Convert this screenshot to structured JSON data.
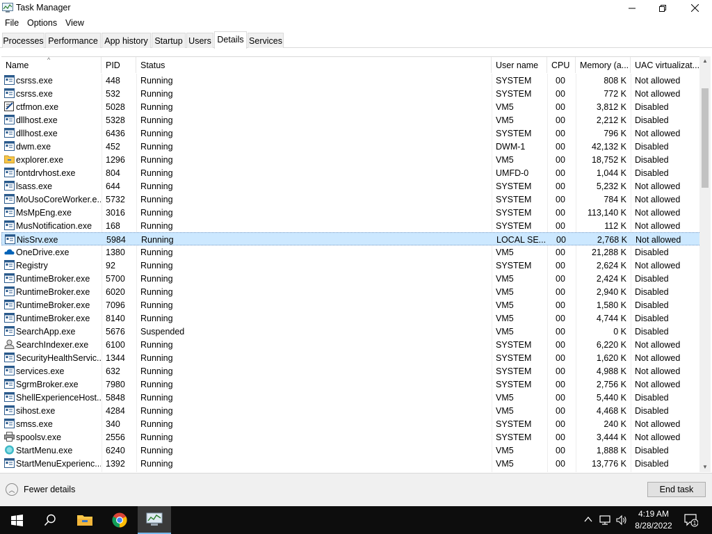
{
  "window": {
    "title": "Task Manager"
  },
  "menu": [
    "File",
    "Options",
    "View"
  ],
  "tabs": [
    {
      "label": "Processes",
      "active": false
    },
    {
      "label": "Performance",
      "active": false
    },
    {
      "label": "App history",
      "active": false
    },
    {
      "label": "Startup",
      "active": false
    },
    {
      "label": "Users",
      "active": false
    },
    {
      "label": "Details",
      "active": true
    },
    {
      "label": "Services",
      "active": false
    }
  ],
  "columns": [
    "Name",
    "PID",
    "Status",
    "User name",
    "CPU",
    "Memory (a...",
    "UAC virtualizat..."
  ],
  "rows": [
    {
      "icon": "generic-app-icon",
      "name": "csrss.exe",
      "pid": "448",
      "status": "Running",
      "user": "SYSTEM",
      "cpu": "00",
      "memory": "808 K",
      "uac": "Not allowed"
    },
    {
      "icon": "generic-app-icon",
      "name": "csrss.exe",
      "pid": "532",
      "status": "Running",
      "user": "SYSTEM",
      "cpu": "00",
      "memory": "772 K",
      "uac": "Not allowed"
    },
    {
      "icon": "ctfmon-icon",
      "name": "ctfmon.exe",
      "pid": "5028",
      "status": "Running",
      "user": "VM5",
      "cpu": "00",
      "memory": "3,812 K",
      "uac": "Disabled"
    },
    {
      "icon": "generic-app-icon",
      "name": "dllhost.exe",
      "pid": "5328",
      "status": "Running",
      "user": "VM5",
      "cpu": "00",
      "memory": "2,212 K",
      "uac": "Disabled"
    },
    {
      "icon": "generic-app-icon",
      "name": "dllhost.exe",
      "pid": "6436",
      "status": "Running",
      "user": "SYSTEM",
      "cpu": "00",
      "memory": "796 K",
      "uac": "Not allowed"
    },
    {
      "icon": "generic-app-icon",
      "name": "dwm.exe",
      "pid": "452",
      "status": "Running",
      "user": "DWM-1",
      "cpu": "00",
      "memory": "42,132 K",
      "uac": "Disabled"
    },
    {
      "icon": "folder-icon",
      "name": "explorer.exe",
      "pid": "1296",
      "status": "Running",
      "user": "VM5",
      "cpu": "00",
      "memory": "18,752 K",
      "uac": "Disabled"
    },
    {
      "icon": "generic-app-icon",
      "name": "fontdrvhost.exe",
      "pid": "804",
      "status": "Running",
      "user": "UMFD-0",
      "cpu": "00",
      "memory": "1,044 K",
      "uac": "Disabled"
    },
    {
      "icon": "generic-app-icon",
      "name": "lsass.exe",
      "pid": "644",
      "status": "Running",
      "user": "SYSTEM",
      "cpu": "00",
      "memory": "5,232 K",
      "uac": "Not allowed"
    },
    {
      "icon": "generic-app-icon",
      "name": "MoUsoCoreWorker.e...",
      "pid": "5732",
      "status": "Running",
      "user": "SYSTEM",
      "cpu": "00",
      "memory": "784 K",
      "uac": "Not allowed"
    },
    {
      "icon": "generic-app-icon",
      "name": "MsMpEng.exe",
      "pid": "3016",
      "status": "Running",
      "user": "SYSTEM",
      "cpu": "00",
      "memory": "113,140 K",
      "uac": "Not allowed"
    },
    {
      "icon": "generic-app-icon",
      "name": "MusNotification.exe",
      "pid": "168",
      "status": "Running",
      "user": "SYSTEM",
      "cpu": "00",
      "memory": "112 K",
      "uac": "Not allowed"
    },
    {
      "icon": "generic-app-icon",
      "name": "NisSrv.exe",
      "pid": "5984",
      "status": "Running",
      "user": "LOCAL SE...",
      "cpu": "00",
      "memory": "2,768 K",
      "uac": "Not allowed",
      "selected": true
    },
    {
      "icon": "onedrive-icon",
      "name": "OneDrive.exe",
      "pid": "1380",
      "status": "Running",
      "user": "VM5",
      "cpu": "00",
      "memory": "21,288 K",
      "uac": "Disabled"
    },
    {
      "icon": "generic-app-icon",
      "name": "Registry",
      "pid": "92",
      "status": "Running",
      "user": "SYSTEM",
      "cpu": "00",
      "memory": "2,624 K",
      "uac": "Not allowed"
    },
    {
      "icon": "generic-app-icon",
      "name": "RuntimeBroker.exe",
      "pid": "5700",
      "status": "Running",
      "user": "VM5",
      "cpu": "00",
      "memory": "2,424 K",
      "uac": "Disabled"
    },
    {
      "icon": "generic-app-icon",
      "name": "RuntimeBroker.exe",
      "pid": "6020",
      "status": "Running",
      "user": "VM5",
      "cpu": "00",
      "memory": "2,940 K",
      "uac": "Disabled"
    },
    {
      "icon": "generic-app-icon",
      "name": "RuntimeBroker.exe",
      "pid": "7096",
      "status": "Running",
      "user": "VM5",
      "cpu": "00",
      "memory": "1,580 K",
      "uac": "Disabled"
    },
    {
      "icon": "generic-app-icon",
      "name": "RuntimeBroker.exe",
      "pid": "8140",
      "status": "Running",
      "user": "VM5",
      "cpu": "00",
      "memory": "4,744 K",
      "uac": "Disabled"
    },
    {
      "icon": "generic-app-icon",
      "name": "SearchApp.exe",
      "pid": "5676",
      "status": "Suspended",
      "user": "VM5",
      "cpu": "00",
      "memory": "0 K",
      "uac": "Disabled"
    },
    {
      "icon": "search-indexer-icon",
      "name": "SearchIndexer.exe",
      "pid": "6100",
      "status": "Running",
      "user": "SYSTEM",
      "cpu": "00",
      "memory": "6,220 K",
      "uac": "Not allowed"
    },
    {
      "icon": "generic-app-icon",
      "name": "SecurityHealthServic...",
      "pid": "1344",
      "status": "Running",
      "user": "SYSTEM",
      "cpu": "00",
      "memory": "1,620 K",
      "uac": "Not allowed"
    },
    {
      "icon": "generic-app-icon",
      "name": "services.exe",
      "pid": "632",
      "status": "Running",
      "user": "SYSTEM",
      "cpu": "00",
      "memory": "4,988 K",
      "uac": "Not allowed"
    },
    {
      "icon": "generic-app-icon",
      "name": "SgrmBroker.exe",
      "pid": "7980",
      "status": "Running",
      "user": "SYSTEM",
      "cpu": "00",
      "memory": "2,756 K",
      "uac": "Not allowed"
    },
    {
      "icon": "generic-app-icon",
      "name": "ShellExperienceHost....",
      "pid": "5848",
      "status": "Running",
      "user": "VM5",
      "cpu": "00",
      "memory": "5,440 K",
      "uac": "Disabled"
    },
    {
      "icon": "generic-app-icon",
      "name": "sihost.exe",
      "pid": "4284",
      "status": "Running",
      "user": "VM5",
      "cpu": "00",
      "memory": "4,468 K",
      "uac": "Disabled"
    },
    {
      "icon": "generic-app-icon",
      "name": "smss.exe",
      "pid": "340",
      "status": "Running",
      "user": "SYSTEM",
      "cpu": "00",
      "memory": "240 K",
      "uac": "Not allowed"
    },
    {
      "icon": "printer-icon",
      "name": "spoolsv.exe",
      "pid": "2556",
      "status": "Running",
      "user": "SYSTEM",
      "cpu": "00",
      "memory": "3,444 K",
      "uac": "Not allowed"
    },
    {
      "icon": "startmenu-icon",
      "name": "StartMenu.exe",
      "pid": "6240",
      "status": "Running",
      "user": "VM5",
      "cpu": "00",
      "memory": "1,888 K",
      "uac": "Disabled"
    },
    {
      "icon": "generic-app-icon",
      "name": "StartMenuExperienc...",
      "pid": "1392",
      "status": "Running",
      "user": "VM5",
      "cpu": "00",
      "memory": "13,776 K",
      "uac": "Disabled"
    }
  ],
  "footer": {
    "fewer_details": "Fewer details",
    "end_task": "End task"
  },
  "taskbar": {
    "apps": [
      "windows-start-icon",
      "search-icon",
      "file-explorer-icon",
      "chrome-icon",
      "task-manager-icon"
    ],
    "time": "4:19 AM",
    "date": "8/28/2022",
    "notification_count": "1"
  },
  "colors": {
    "selection": "#cce8ff",
    "taskbar": "#0d0d0d",
    "accent": "#76b9ed"
  }
}
